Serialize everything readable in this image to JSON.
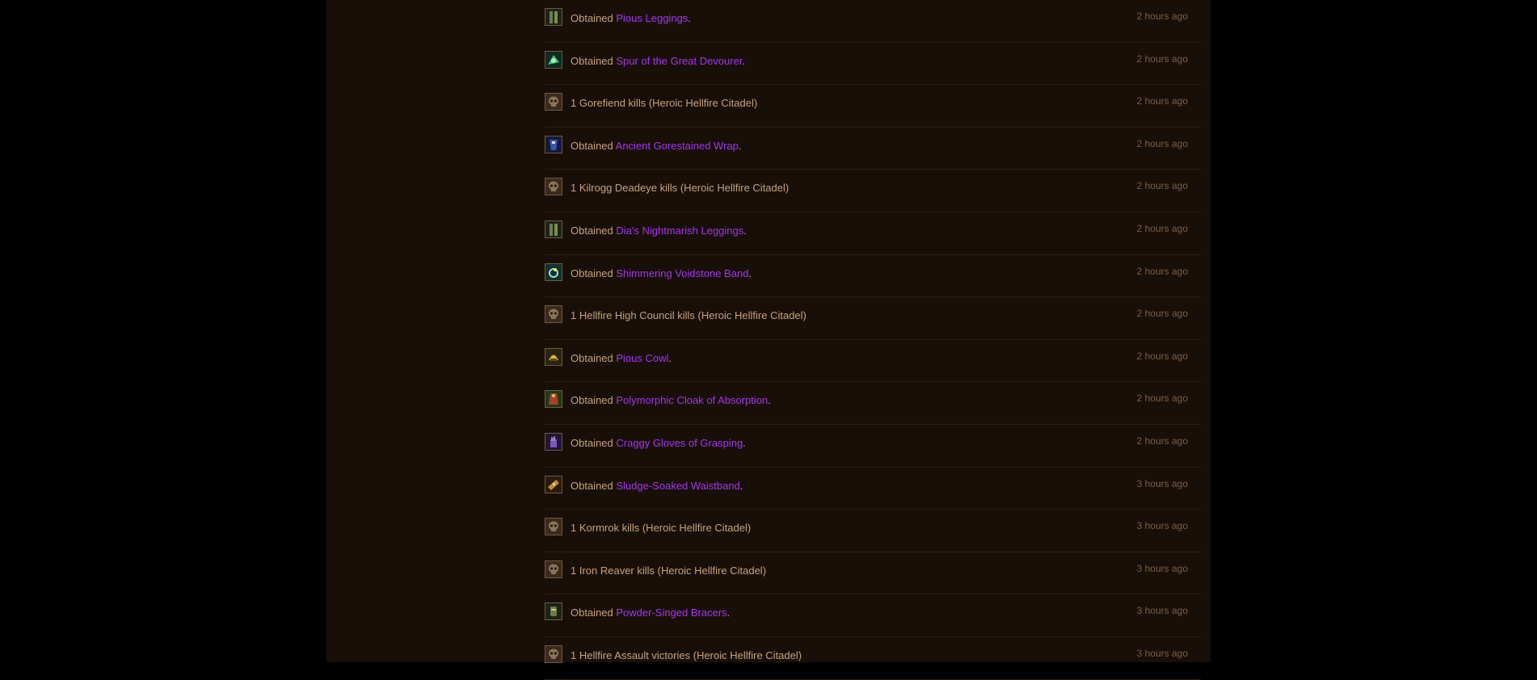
{
  "feed": [
    {
      "type": "loot",
      "icon": "legs-icon",
      "prefix": "Obtained ",
      "item": "Pious Leggings",
      "suffix": ".",
      "time": "2 hours ago"
    },
    {
      "type": "loot",
      "icon": "trinket-icon",
      "prefix": "Obtained ",
      "item": "Spur of the Great Devourer",
      "suffix": ".",
      "time": "2 hours ago"
    },
    {
      "type": "kill",
      "icon": "skull-icon",
      "text": "1 Gorefiend kills (Heroic Hellfire Citadel)",
      "time": "2 hours ago"
    },
    {
      "type": "loot",
      "icon": "wrap-icon",
      "prefix": "Obtained ",
      "item": "Ancient Gorestained Wrap",
      "suffix": ".",
      "time": "2 hours ago"
    },
    {
      "type": "kill",
      "icon": "skull-icon",
      "text": "1 Kilrogg Deadeye kills (Heroic Hellfire Citadel)",
      "time": "2 hours ago"
    },
    {
      "type": "loot",
      "icon": "legs-icon",
      "prefix": "Obtained ",
      "item": "Dia's Nightmarish Leggings",
      "suffix": ".",
      "time": "2 hours ago"
    },
    {
      "type": "loot",
      "icon": "ring-icon",
      "prefix": "Obtained ",
      "item": "Shimmering Voidstone Band",
      "suffix": ".",
      "time": "2 hours ago"
    },
    {
      "type": "kill",
      "icon": "skull-icon",
      "text": "1 Hellfire High Council kills (Heroic Hellfire Citadel)",
      "time": "2 hours ago"
    },
    {
      "type": "loot",
      "icon": "helm-icon",
      "prefix": "Obtained ",
      "item": "Pious Cowl",
      "suffix": ".",
      "time": "2 hours ago"
    },
    {
      "type": "loot",
      "icon": "cloak-icon",
      "prefix": "Obtained ",
      "item": "Polymorphic Cloak of Absorption",
      "suffix": ".",
      "time": "2 hours ago"
    },
    {
      "type": "loot",
      "icon": "gloves-icon",
      "prefix": "Obtained ",
      "item": "Craggy Gloves of Grasping",
      "suffix": ".",
      "time": "2 hours ago"
    },
    {
      "type": "loot",
      "icon": "belt-icon",
      "prefix": "Obtained ",
      "item": "Sludge-Soaked Waistband",
      "suffix": ".",
      "time": "3 hours ago"
    },
    {
      "type": "kill",
      "icon": "skull-icon",
      "text": "1 Kormrok kills (Heroic Hellfire Citadel)",
      "time": "3 hours ago"
    },
    {
      "type": "kill",
      "icon": "skull-icon",
      "text": "1 Iron Reaver kills (Heroic Hellfire Citadel)",
      "time": "3 hours ago"
    },
    {
      "type": "loot",
      "icon": "bracers-icon",
      "prefix": "Obtained ",
      "item": "Powder-Singed Bracers",
      "suffix": ".",
      "time": "3 hours ago"
    },
    {
      "type": "kill",
      "icon": "skull-icon",
      "text": "1 Hellfire Assault victories (Heroic Hellfire Citadel)",
      "time": "3 hours ago"
    }
  ],
  "colors": {
    "background": "#000000",
    "panel": "#190f09",
    "text": "#c6a27b",
    "epic_item": "#a335ee",
    "timestamp": "#7a5f40",
    "divider": "#2c1f13"
  }
}
